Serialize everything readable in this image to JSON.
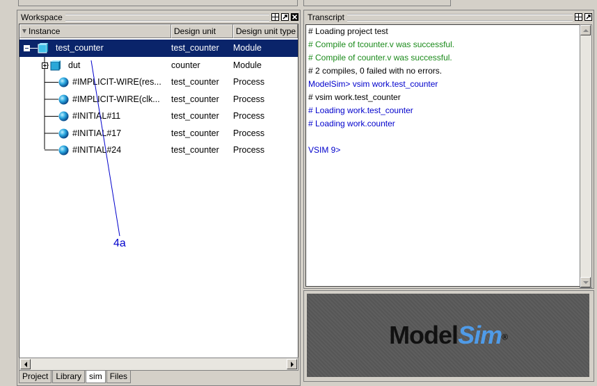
{
  "workspace": {
    "title": "Workspace",
    "columns": [
      "Instance",
      "Design unit",
      "Design unit type"
    ],
    "rows": [
      {
        "instance": "test_counter",
        "unit": "test_counter",
        "type": "Module"
      },
      {
        "instance": "dut",
        "unit": "counter",
        "type": "Module"
      },
      {
        "instance": "#IMPLICIT-WIRE(res...",
        "unit": "test_counter",
        "type": "Process"
      },
      {
        "instance": "#IMPLICIT-WIRE(clk...",
        "unit": "test_counter",
        "type": "Process"
      },
      {
        "instance": "#INITIAL#11",
        "unit": "test_counter",
        "type": "Process"
      },
      {
        "instance": "#INITIAL#17",
        "unit": "test_counter",
        "type": "Process"
      },
      {
        "instance": "#INITIAL#24",
        "unit": "test_counter",
        "type": "Process"
      }
    ],
    "tabs": [
      "Project",
      "Library",
      "sim",
      "Files"
    ],
    "active_tab": "sim"
  },
  "transcript": {
    "title": "Transcript",
    "lines": [
      {
        "text": "# Loading project test",
        "color": "#000000"
      },
      {
        "text": "# Compile of tcounter.v was successful.",
        "color": "#1a8a1a"
      },
      {
        "text": "# Compile of counter.v was successful.",
        "color": "#1a8a1a"
      },
      {
        "text": "# 2 compiles, 0 failed with no errors.",
        "color": "#000000"
      },
      {
        "text": "ModelSim>  vsim work.test_counter",
        "color": "#0000cc",
        "mixed": true
      },
      {
        "text": "# vsim work.test_counter",
        "color": "#000000"
      },
      {
        "text": "# Loading work.test_counter",
        "color": "#0000cc"
      },
      {
        "text": "# Loading work.counter",
        "color": "#0000cc"
      },
      {
        "text": "",
        "color": "#000000"
      },
      {
        "text": "VSIM 9>",
        "color": "#0000cc"
      }
    ]
  },
  "logo": {
    "model": "Model",
    "sim": "Sim",
    "reg": "®"
  },
  "annotation": "4a",
  "colors": {
    "selection": "#0a246a",
    "pane_bg": "#d4d0c8",
    "compile_ok": "#1a8a1a",
    "prompt_blue": "#0000cc"
  }
}
